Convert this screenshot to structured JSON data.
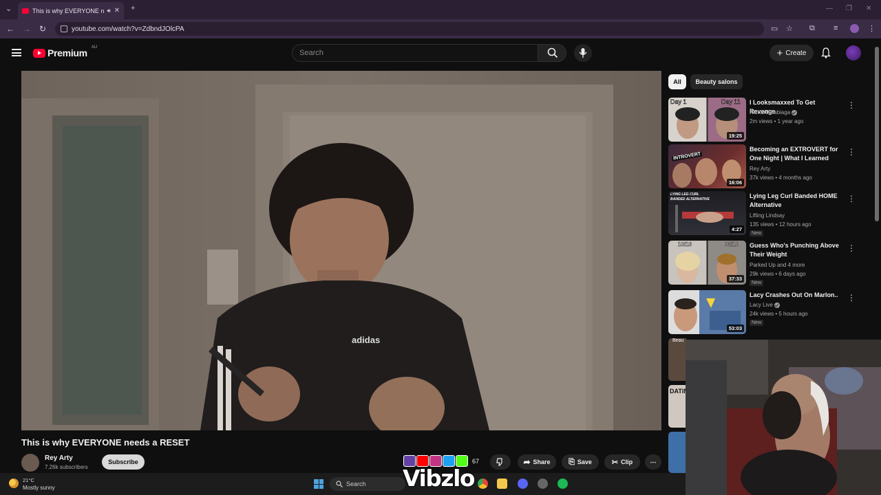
{
  "browser": {
    "tab_title": "This is why EVERYONE nee",
    "url": "youtube.com/watch?v=ZdbndJOlcPA"
  },
  "header": {
    "logo_text": "Premium",
    "region": "AU",
    "search_placeholder": "Search",
    "create_label": "Create"
  },
  "video": {
    "title": "This is why EVERYONE needs a RESET",
    "shirt_text": "adidas",
    "channel": "Rey Arty",
    "subscribers": "7.26k subscribers",
    "subscribe_label": "Subscribe",
    "like_count": "67",
    "share_label": "Share",
    "save_label": "Save",
    "clip_label": "Clip"
  },
  "sidebar": {
    "chips": [
      "All",
      "Beauty salons"
    ],
    "recommendations": [
      {
        "title": "I Looksmaxxed To Get Revenge",
        "channel": "Richard Sabiaga",
        "verified": true,
        "meta": "2m views • 1 year ago",
        "duration": "19:25",
        "badge": "",
        "thumb_labels": [
          "Day 1",
          "Day 11"
        ]
      },
      {
        "title": "Becoming an EXTROVERT for One Night | What I Learned",
        "channel": "Rey Arty",
        "verified": false,
        "meta": "37k views • 4 months ago",
        "duration": "16:06",
        "badge": "",
        "thumb_labels": [
          "INTROVERT"
        ]
      },
      {
        "title": "Lying Leg Curl Banded HOME Alternative",
        "channel": "Lifting Lindsay",
        "verified": false,
        "meta": "135 views • 12 hours ago",
        "duration": "4:27",
        "badge": "New",
        "thumb_labels": [
          "LYING LEG CURL",
          "BANDED ALTERNATIVE"
        ]
      },
      {
        "title": "Guess Who's Punching Above Their Weight",
        "channel": "Parked Up and 4 more",
        "verified": false,
        "meta": "29k views • 6 days ago",
        "duration": "37:33",
        "badge": "New",
        "thumb_labels": [
          "10/10",
          "03/10"
        ]
      },
      {
        "title": "Lacy Crashes Out On Marlon..",
        "channel": "Lacy Live",
        "verified": true,
        "meta": "24k views • 5 hours ago",
        "duration": "53:03",
        "badge": "New",
        "thumb_labels": []
      }
    ],
    "partial_thumb_labels": [
      "Beau",
      "DATIN"
    ]
  },
  "taskbar": {
    "temperature": "21°C",
    "condition": "Mostly sunny",
    "search_label": "Search"
  },
  "overlay": {
    "brand": "Vibzlo"
  },
  "colors": {
    "youtube_red": "#ff0033",
    "background": "#0f0f0f",
    "browser_chrome": "#3a2c44"
  }
}
